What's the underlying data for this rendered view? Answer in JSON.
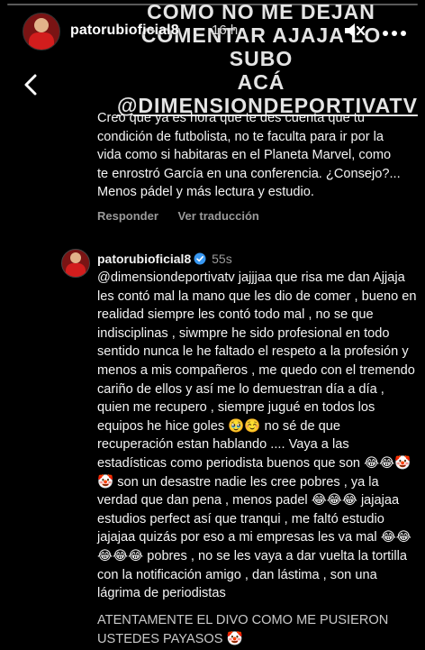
{
  "story": {
    "progress_fraction": 0.0,
    "user": {
      "username": "patorubioficial8",
      "time": "16 h"
    },
    "icons": {
      "mute": "speaker-mute-icon",
      "more": "more-horizontal-icon",
      "back": "chevron-left-icon"
    }
  },
  "overlay": {
    "lines": [
      "COMO NO ME DEJAN",
      "COMENTAR AJAJA LO SUBO",
      "ACÁ",
      "@DIMENSIONDEPORTIVATV"
    ]
  },
  "comment": {
    "text": "Creo que ya es hora que te des cuenta que tu condición de futbolista, no te faculta para ir por la vida como si habitaras en el Planeta Marvel, como te enrostró García en una conferencia. ¿Consejo?... Menos pádel y más lectura y estudio.",
    "reply_label": "Responder",
    "translate_label": "Ver traducción"
  },
  "reply": {
    "username": "patorubioficial8",
    "ago": "55s",
    "text": "@dimensiondeportivatv jajjjaa que risa me dan Ajjaja les contó mal la mano que les dio de comer , bueno en realidad siempre les contó todo mal , no se que indisciplinas , siwmpre he sido profesional en todo sentido nunca le he faltado el respeto a la profesión y menos a mis compañeros , me quedo con el tremendo cariño de ellos y así me lo demuestran día a día , quien me recupero , siempre jugué en todos los equipos he hice goles 🥹☺️ no sé de que recuperación estan hablando .... Vaya a las estadísticas como periodista buenos que son 😂😂🤡🤡 son un desastre nadie les cree pobres , ya la verdad que dan pena , menos padel 😂😂😂 jajajaa estudios perfect así que tranqui , me faltó estudio jajajaa quizás por eso a mi empresas les va mal 😂😂😂😂😂 pobres , no se les vaya a dar vuelta la tortilla con la notificación amigo , dan lástima , son una lágrima de periodistas",
    "tail": "ATENTAMENTE EL DIVO COMO ME PUSIERON USTEDES PAYASOS 🤡"
  },
  "colors": {
    "verified": "#3897f0",
    "muted_text": "#9a9a9a"
  }
}
